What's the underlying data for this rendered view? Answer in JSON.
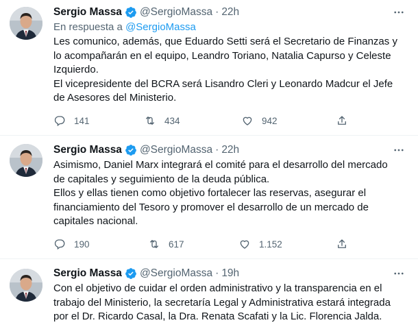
{
  "tweets": [
    {
      "author": "Sergio Massa",
      "handle": "@SergioMassa",
      "separator": "·",
      "time": "22h",
      "reply_prefix": "En respuesta a",
      "reply_to": "@SergioMassa",
      "paragraphs": [
        "Les comunico, además, que Eduardo Setti será el Secretario de Finanzas y lo acompañarán en el equipo, Leandro Toriano, Natalia Capurso y Celeste Izquierdo.",
        "El vicepresidente del BCRA será Lisandro Cleri y Leonardo Madcur el Jefe de Asesores del Ministerio."
      ],
      "replies": "141",
      "retweets": "434",
      "likes": "942"
    },
    {
      "author": "Sergio Massa",
      "handle": "@SergioMassa",
      "separator": "·",
      "time": "22h",
      "paragraphs": [
        "Asimismo, Daniel Marx integrará el comité para el desarrollo del mercado de capitales y seguimiento de la deuda pública.",
        "Ellos y ellas tienen como objetivo fortalecer las reservas, asegurar el financiamiento del Tesoro y promover el desarrollo de un mercado de capitales nacional."
      ],
      "replies": "190",
      "retweets": "617",
      "likes": "1.152"
    },
    {
      "author": "Sergio Massa",
      "handle": "@SergioMassa",
      "separator": "·",
      "time": "19h",
      "paragraphs": [
        "Con el objetivo de cuidar el orden administrativo y la transparencia en el trabajo del Ministerio, la secretaría Legal y Administrativa estará integrada por el Dr. Ricardo Casal, la Dra. Renata Scafati y la Lic. Florencia Jalda."
      ]
    }
  ],
  "icons": {
    "verified": "verified-badge-icon",
    "more": "more-options-icon",
    "reply": "reply-icon",
    "retweet": "retweet-icon",
    "like": "like-icon",
    "share": "share-icon"
  },
  "colors": {
    "accent": "#1d9bf0",
    "secondary_text": "#536471",
    "divider": "#eff3f4"
  }
}
